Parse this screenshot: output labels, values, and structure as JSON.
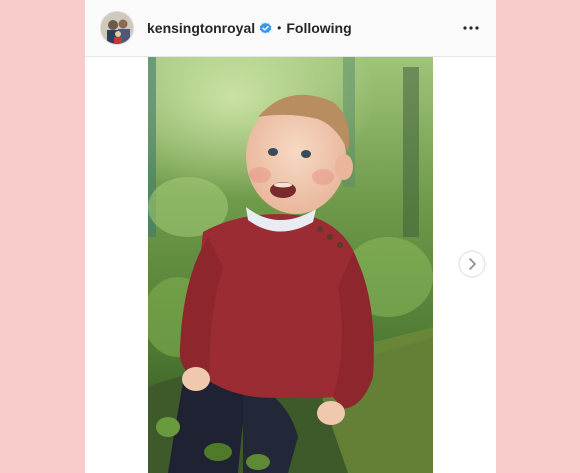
{
  "post": {
    "username": "kensingtonroyal",
    "separator": "•",
    "follow_status": "Following"
  },
  "icons": {
    "avatar": "profile-avatar",
    "verified": "verified-badge-icon",
    "more": "more-options-icon",
    "next": "chevron-right-icon"
  },
  "colors": {
    "background": "#f9cccc",
    "verified": "#3897f0",
    "text": "#262626"
  }
}
